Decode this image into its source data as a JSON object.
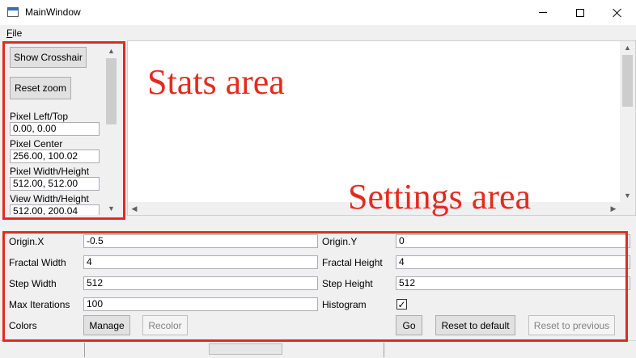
{
  "window": {
    "title": "MainWindow",
    "controls": [
      "minimize-icon",
      "maximize-icon",
      "close-icon"
    ]
  },
  "menu": {
    "items": [
      {
        "label": "ile",
        "access_key": "F"
      }
    ]
  },
  "stats": {
    "show_crosshair": "Show Crosshair",
    "reset_zoom": "Reset zoom",
    "pixel_left_top_label": "Pixel Left/Top",
    "pixel_left_top_value": "0.00, 0.00",
    "pixel_center_label": "Pixel Center",
    "pixel_center_value": "256.00, 100.02",
    "pixel_wh_label": "Pixel Width/Height",
    "pixel_wh_value": "512.00, 512.00",
    "view_wh_label": "View Width/Height",
    "view_wh_value": "512.00, 200.04"
  },
  "settings": {
    "origin_x_label": "Origin.X",
    "origin_x_value": "-0.5",
    "origin_y_label": "Origin.Y",
    "origin_y_value": "0",
    "fractal_width_label": "Fractal Width",
    "fractal_width_value": "4",
    "fractal_height_label": "Fractal Height",
    "fractal_height_value": "4",
    "step_width_label": "Step Width",
    "step_width_value": "512",
    "step_height_label": "Step Height",
    "step_height_value": "512",
    "max_iterations_label": "Max Iterations",
    "max_iterations_value": "100",
    "histogram_label": "Histogram",
    "histogram_checked": true,
    "histogram_check_glyph": "✓",
    "colors_label": "Colors",
    "manage_button": "Manage",
    "recolor_button": "Recolor",
    "go_button": "Go",
    "reset_default_button": "Reset to default",
    "reset_previous_button": "Reset to previous"
  },
  "annotations": {
    "stats_area": "Stats area",
    "settings_area": "Settings area",
    "color": "#e52a20"
  }
}
